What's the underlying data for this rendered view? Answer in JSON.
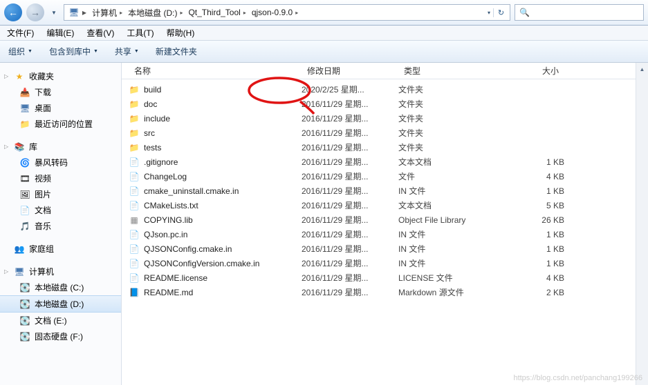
{
  "nav": {
    "breadcrumb": [
      {
        "icon": "computer-icon",
        "label": "计算机"
      },
      {
        "label": "本地磁盘 (D:)"
      },
      {
        "label": "Qt_Third_Tool"
      },
      {
        "label": "qjson-0.9.0"
      }
    ],
    "search_cut": ""
  },
  "menu": {
    "file": "文件(F)",
    "edit": "编辑(E)",
    "view": "查看(V)",
    "tools": "工具(T)",
    "help": "帮助(H)"
  },
  "toolbar": {
    "organize": "组织",
    "include": "包含到库中",
    "share": "共享",
    "newfolder": "新建文件夹"
  },
  "columns": {
    "name": "名称",
    "date": "修改日期",
    "type": "类型",
    "size": "大小"
  },
  "sidebar": {
    "favorites": {
      "label": "收藏夹",
      "items": [
        {
          "icon": "download-icon",
          "label": "下载"
        },
        {
          "icon": "desktop-icon",
          "label": "桌面"
        },
        {
          "icon": "recent-icon",
          "label": "最近访问的位置"
        }
      ]
    },
    "libraries": {
      "label": "库",
      "items": [
        {
          "icon": "storm-icon",
          "label": "暴风转码"
        },
        {
          "icon": "video-icon",
          "label": "视频"
        },
        {
          "icon": "picture-icon",
          "label": "图片"
        },
        {
          "icon": "document-icon",
          "label": "文档"
        },
        {
          "icon": "music-icon",
          "label": "音乐"
        }
      ]
    },
    "homegroup": {
      "label": "家庭组"
    },
    "computer": {
      "label": "计算机",
      "items": [
        {
          "icon": "drive-icon",
          "label": "本地磁盘 (C:)"
        },
        {
          "icon": "drive-icon",
          "label": "本地磁盘 (D:)",
          "selected": true
        },
        {
          "icon": "drive-icon",
          "label": "文档 (E:)"
        },
        {
          "icon": "drive-icon",
          "label": "固态硬盘 (F:)"
        }
      ]
    }
  },
  "files": [
    {
      "icon": "folder",
      "name": "build",
      "date": "2020/2/25 星期...",
      "type": "文件夹",
      "size": ""
    },
    {
      "icon": "folder",
      "name": "doc",
      "date": "2016/11/29 星期...",
      "type": "文件夹",
      "size": ""
    },
    {
      "icon": "folder",
      "name": "include",
      "date": "2016/11/29 星期...",
      "type": "文件夹",
      "size": ""
    },
    {
      "icon": "folder",
      "name": "src",
      "date": "2016/11/29 星期...",
      "type": "文件夹",
      "size": ""
    },
    {
      "icon": "folder",
      "name": "tests",
      "date": "2016/11/29 星期...",
      "type": "文件夹",
      "size": ""
    },
    {
      "icon": "file",
      "name": ".gitignore",
      "date": "2016/11/29 星期...",
      "type": "文本文档",
      "size": "1 KB"
    },
    {
      "icon": "file",
      "name": "ChangeLog",
      "date": "2016/11/29 星期...",
      "type": "文件",
      "size": "4 KB"
    },
    {
      "icon": "file",
      "name": "cmake_uninstall.cmake.in",
      "date": "2016/11/29 星期...",
      "type": "IN 文件",
      "size": "1 KB"
    },
    {
      "icon": "file",
      "name": "CMakeLists.txt",
      "date": "2016/11/29 星期...",
      "type": "文本文档",
      "size": "5 KB"
    },
    {
      "icon": "lib",
      "name": "COPYING.lib",
      "date": "2016/11/29 星期...",
      "type": "Object File Library",
      "size": "26 KB"
    },
    {
      "icon": "file",
      "name": "QJson.pc.in",
      "date": "2016/11/29 星期...",
      "type": "IN 文件",
      "size": "1 KB"
    },
    {
      "icon": "file",
      "name": "QJSONConfig.cmake.in",
      "date": "2016/11/29 星期...",
      "type": "IN 文件",
      "size": "1 KB"
    },
    {
      "icon": "file",
      "name": "QJSONConfigVersion.cmake.in",
      "date": "2016/11/29 星期...",
      "type": "IN 文件",
      "size": "1 KB"
    },
    {
      "icon": "file",
      "name": "README.license",
      "date": "2016/11/29 星期...",
      "type": "LICENSE 文件",
      "size": "4 KB"
    },
    {
      "icon": "md",
      "name": "README.md",
      "date": "2016/11/29 星期...",
      "type": "Markdown 源文件",
      "size": "2 KB"
    }
  ],
  "watermark": "https://blog.csdn.net/panchang199266"
}
